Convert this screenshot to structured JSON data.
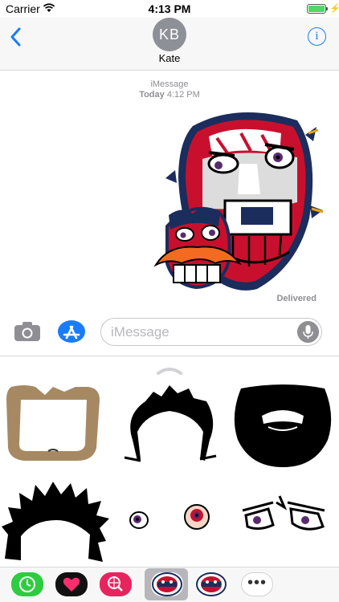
{
  "status_bar": {
    "carrier": "Carrier",
    "time": "4:13 PM",
    "battery_level": 1.0,
    "charging_icon": "lightning-bolt-icon"
  },
  "header": {
    "avatar_initials": "KB",
    "contact_name": "Kate",
    "back_icon": "chevron-left-icon",
    "info_icon": "info-icon"
  },
  "conversation": {
    "service_label": "iMessage",
    "date_label": "Today",
    "time_label": "4:12 PM",
    "delivery_status": "Delivered"
  },
  "compose": {
    "placeholder": "iMessage",
    "camera_icon": "camera-icon",
    "appstore_icon": "app-store-icon",
    "mic_icon": "microphone-icon"
  },
  "drawer": {
    "stickers": [
      "tan-goalie-mask-sticker",
      "black-hair-sticker",
      "black-beard-sticker",
      "spiky-black-hair-sticker",
      "small-eyes-sticker",
      "angry-eyes-sticker"
    ]
  },
  "tray": {
    "apps": [
      "recents-app",
      "digital-touch-app",
      "image-search-app",
      "hockey-mask-sticker-app-selected",
      "hockey-mask-sticker-app"
    ],
    "more_label": "•••"
  },
  "colors": {
    "accent_blue": "#1a7cf5",
    "avatar_gray": "#8e9097",
    "mask_red": "#c8102e",
    "mask_navy": "#1b2d5c"
  }
}
